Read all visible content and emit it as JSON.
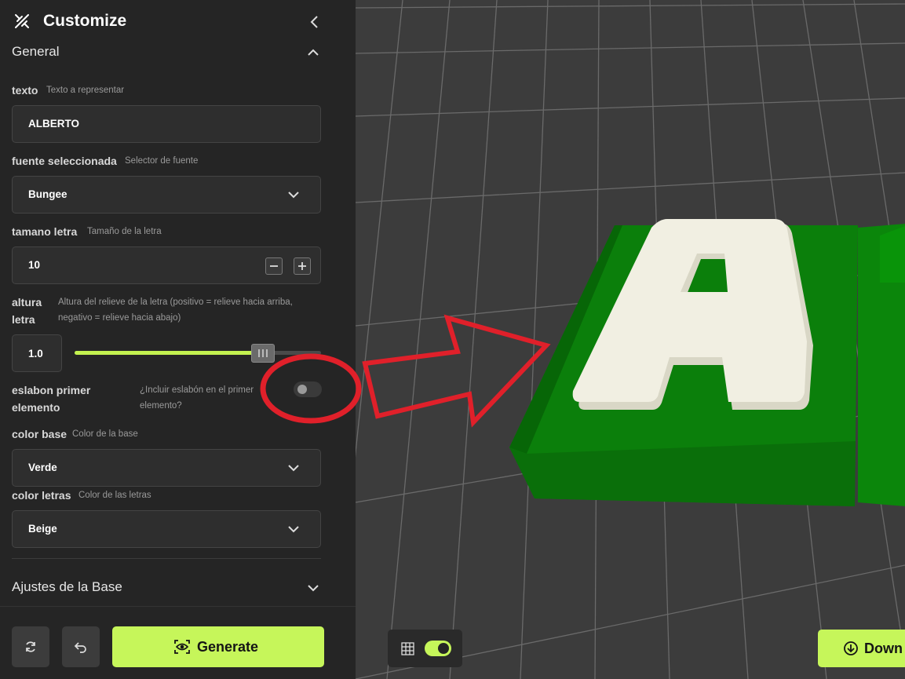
{
  "app": {
    "title": "Customize"
  },
  "sections": {
    "general": {
      "label": "General"
    },
    "base": {
      "label": "Ajustes de la Base"
    }
  },
  "fields": {
    "texto": {
      "label": "texto",
      "hint": "Texto a representar",
      "value": "ALBERTO"
    },
    "fuente": {
      "label": "fuente seleccionada",
      "hint": "Selector de fuente",
      "value": "Bungee"
    },
    "tamano": {
      "label": "tamano letra",
      "hint": "Tamaño de la letra",
      "value": "10",
      "minus": "−",
      "plus": "+"
    },
    "altura": {
      "label_line1": "altura",
      "label_line2": "letra",
      "hint_line1": "Altura del relieve de la letra (positivo = relieve hacia arriba,",
      "hint_line2": "negativo = relieve hacia abajo)",
      "value": "1.0",
      "slider_fraction": 0.76
    },
    "eslabon": {
      "label_line1": "eslabon primer",
      "label_line2": "elemento",
      "hint_line1": "¿Incluir eslabón en el primer",
      "hint_line2": "elemento?",
      "checked": false
    },
    "color_base": {
      "label": "color base",
      "hint": "Color de la base",
      "value": "Verde"
    },
    "color_letras": {
      "label": "color letras",
      "hint": "Color de las letras",
      "value": "Beige"
    }
  },
  "footer": {
    "generate_label": "Generate"
  },
  "viewer": {
    "download_label": "Down",
    "grid_toggle_on": true
  },
  "colors": {
    "accent": "#c6f65a",
    "base_model": "#0f8a0f",
    "letters_model": "#f1efe2",
    "annotation": "#e0202a"
  }
}
